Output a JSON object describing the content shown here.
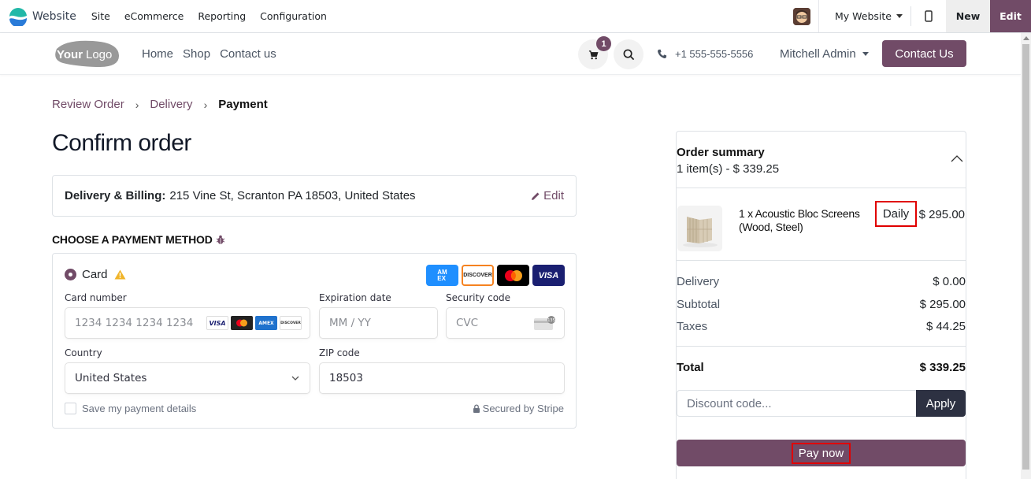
{
  "topbar": {
    "app_name": "Website",
    "menus": [
      "Site",
      "eCommerce",
      "Reporting",
      "Configuration"
    ],
    "website_selector": "My Website",
    "new_label": "New",
    "edit_label": "Edit",
    "colors": {
      "brand": "#714b67"
    }
  },
  "site_header": {
    "logo_text": "YourLogo",
    "nav": [
      "Home",
      "Shop",
      "Contact us"
    ],
    "cart_count": "1",
    "phone": "+1 555-555-5556",
    "user": "Mitchell Admin",
    "contact_button": "Contact Us"
  },
  "breadcrumb": {
    "steps": [
      "Review Order",
      "Delivery",
      "Payment"
    ],
    "current": "Payment"
  },
  "page_title": "Confirm order",
  "delivery": {
    "label": "Delivery & Billing:",
    "address": "215 Vine St, Scranton PA 18503, United States",
    "edit_label": "Edit"
  },
  "payment": {
    "heading": "CHOOSE A PAYMENT METHOD",
    "method_label": "Card",
    "method_selected": true,
    "accepted_brands": [
      "AMEX",
      "DISCOVER",
      "Mastercard",
      "VISA"
    ],
    "card_number": {
      "label": "Card number",
      "placeholder": "1234 1234 1234 1234",
      "value": ""
    },
    "card_brands_inline": [
      "VISA",
      "Mastercard",
      "AMEX",
      "DISCOVER"
    ],
    "expiry": {
      "label": "Expiration date",
      "placeholder": "MM / YY",
      "value": ""
    },
    "cvc": {
      "label": "Security code",
      "placeholder": "CVC",
      "value": "",
      "hint": "135"
    },
    "country": {
      "label": "Country",
      "value": "United States"
    },
    "zip": {
      "label": "ZIP code",
      "value": "18503"
    },
    "save_details": {
      "label": "Save my payment details",
      "checked": false
    },
    "secured_by": "Secured by Stripe"
  },
  "summary": {
    "title": "Order summary",
    "subtitle": "1 item(s) -  $ 339.25",
    "item": {
      "name": "1 x Acoustic Bloc Screens (Wood, Steel)",
      "period": "Daily",
      "price": "$ 295.00"
    },
    "rows": [
      {
        "label": "Delivery",
        "value": "$ 0.00"
      },
      {
        "label": "Subtotal",
        "value": "$ 295.00"
      },
      {
        "label": "Taxes",
        "value": "$ 44.25"
      }
    ],
    "total_label": "Total",
    "total_value": "$ 339.25",
    "discount_placeholder": "Discount code...",
    "apply_label": "Apply",
    "pay_label": "Pay now"
  }
}
